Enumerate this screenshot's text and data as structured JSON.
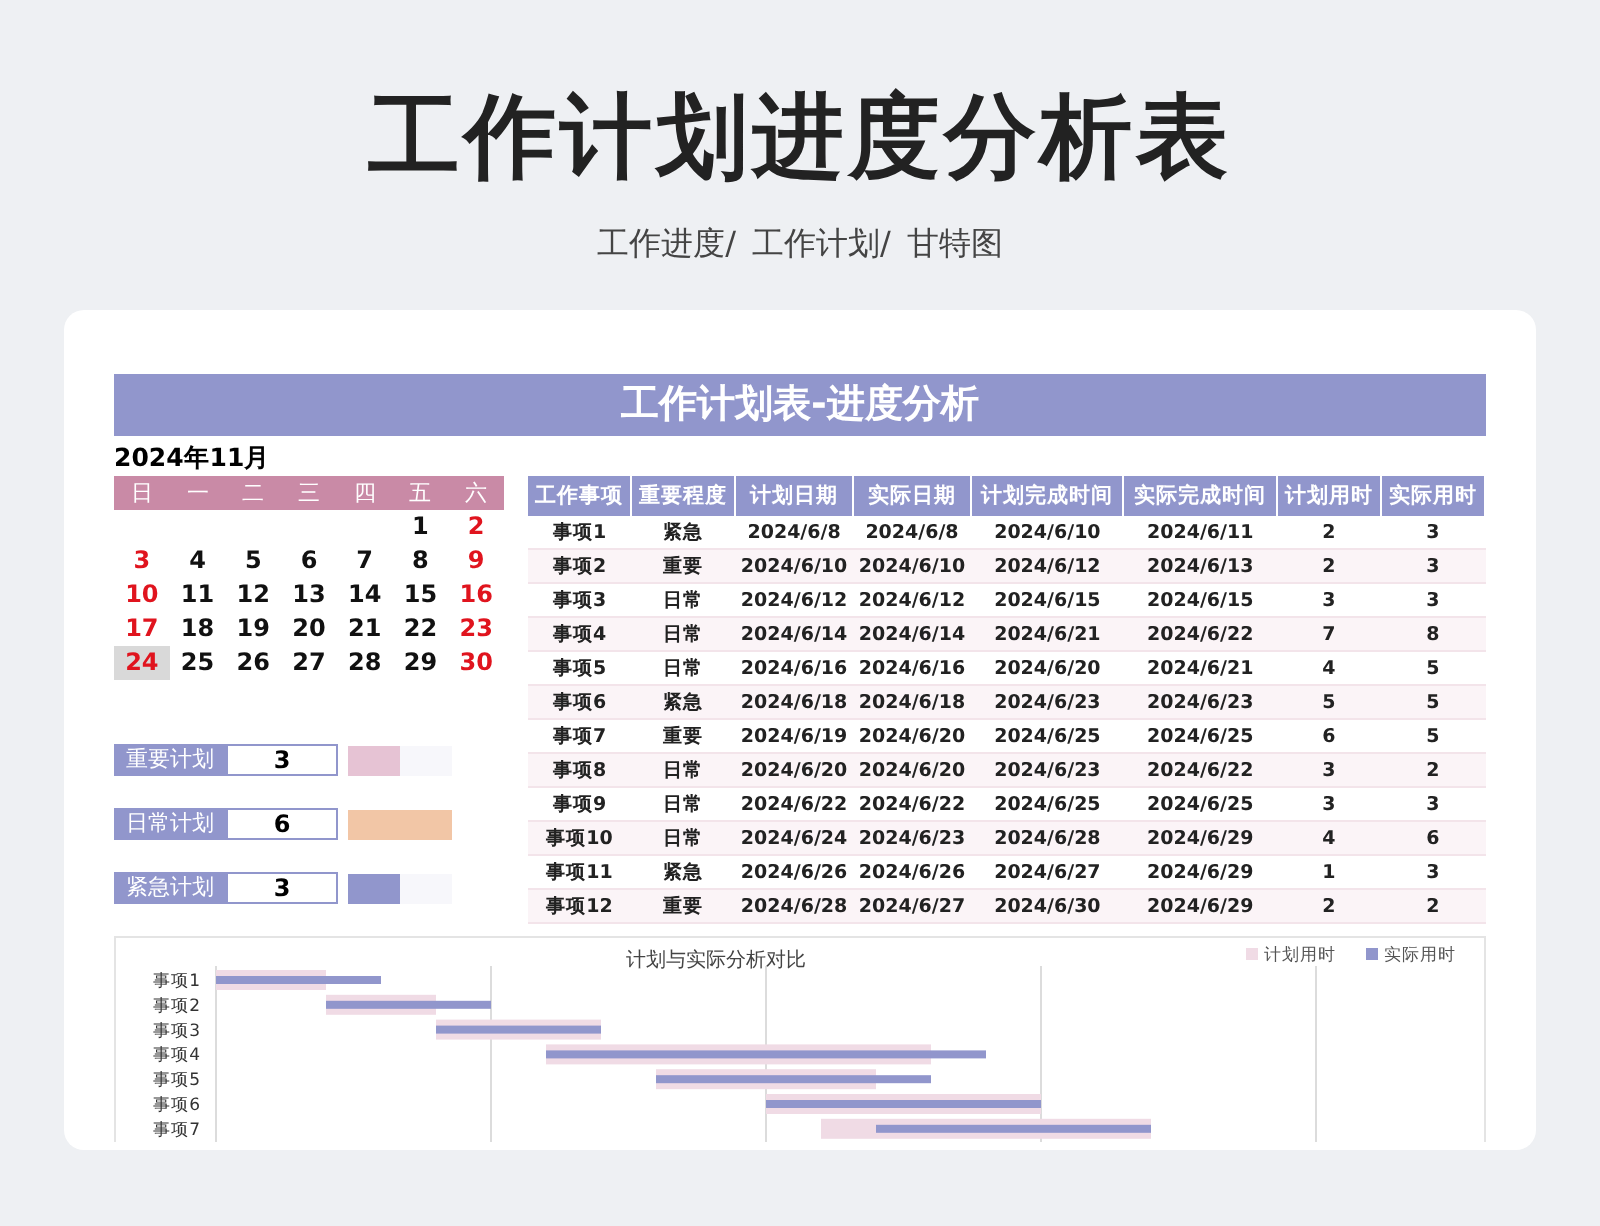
{
  "title": "工作计划进度分析表",
  "subtitle": [
    "工作进度/",
    "工作计划/",
    "甘特图"
  ],
  "banner": "工作计划表-进度分析",
  "calendar": {
    "month": "2024年11月",
    "weekdays": [
      "日",
      "一",
      "二",
      "三",
      "四",
      "五",
      "六"
    ],
    "weeks": [
      [
        {
          "day": "1",
          "selected": false
        },
        {
          "day": "2",
          "selected": false
        }
      ],
      [
        {
          "day": "3",
          "selected": false
        },
        {
          "day": "4",
          "selected": false
        },
        {
          "day": "5",
          "selected": false
        },
        {
          "day": "6",
          "selected": false
        },
        {
          "day": "7",
          "selected": false
        },
        {
          "day": "8",
          "selected": false
        },
        {
          "day": "9",
          "selected": false
        }
      ],
      [
        {
          "day": "10",
          "selected": false
        },
        {
          "day": "11",
          "selected": false
        },
        {
          "day": "12",
          "selected": false
        },
        {
          "day": "13",
          "selected": false
        },
        {
          "day": "14",
          "selected": false
        },
        {
          "day": "15",
          "selected": false
        },
        {
          "day": "16",
          "selected": false
        }
      ],
      [
        {
          "day": "17",
          "selected": false
        },
        {
          "day": "18",
          "selected": false
        },
        {
          "day": "19",
          "selected": false
        },
        {
          "day": "20",
          "selected": false
        },
        {
          "day": "21",
          "selected": false
        },
        {
          "day": "22",
          "selected": false
        },
        {
          "day": "23",
          "selected": false
        }
      ],
      [
        {
          "day": "24",
          "selected": true
        },
        {
          "day": "25",
          "selected": false
        },
        {
          "day": "26",
          "selected": false
        },
        {
          "day": "27",
          "selected": false
        },
        {
          "day": "28",
          "selected": false
        },
        {
          "day": "29",
          "selected": false
        },
        {
          "day": "30",
          "selected": false
        }
      ]
    ]
  },
  "summary": [
    {
      "label": "重要计划",
      "count": "3",
      "color": "#e6c3d4",
      "level": 0.5
    },
    {
      "label": "日常计划",
      "count": "6",
      "color": "#f2c6a6",
      "level": 1
    },
    {
      "label": "紧急计划",
      "count": "3",
      "color": "#9196cc",
      "level": 0.5
    }
  ],
  "table": {
    "columns": [
      "工作事项",
      "重要程度",
      "计划日期",
      "实际日期",
      "计划完成时间",
      "实际完成时间",
      "计划用时",
      "实际用时"
    ],
    "rows": [
      [
        "事项1",
        "紧急",
        "2024/6/8",
        "2024/6/8",
        "2024/6/10",
        "2024/6/11",
        "2",
        "3"
      ],
      [
        "事项2",
        "重要",
        "2024/6/10",
        "2024/6/10",
        "2024/6/12",
        "2024/6/13",
        "2",
        "3"
      ],
      [
        "事项3",
        "日常",
        "2024/6/12",
        "2024/6/12",
        "2024/6/15",
        "2024/6/15",
        "3",
        "3"
      ],
      [
        "事项4",
        "日常",
        "2024/6/14",
        "2024/6/14",
        "2024/6/21",
        "2024/6/22",
        "7",
        "8"
      ],
      [
        "事项5",
        "日常",
        "2024/6/16",
        "2024/6/16",
        "2024/6/20",
        "2024/6/21",
        "4",
        "5"
      ],
      [
        "事项6",
        "紧急",
        "2024/6/18",
        "2024/6/18",
        "2024/6/23",
        "2024/6/23",
        "5",
        "5"
      ],
      [
        "事项7",
        "重要",
        "2024/6/19",
        "2024/6/20",
        "2024/6/25",
        "2024/6/25",
        "6",
        "5"
      ],
      [
        "事项8",
        "日常",
        "2024/6/20",
        "2024/6/20",
        "2024/6/23",
        "2024/6/22",
        "3",
        "2"
      ],
      [
        "事项9",
        "日常",
        "2024/6/22",
        "2024/6/22",
        "2024/6/25",
        "2024/6/25",
        "3",
        "3"
      ],
      [
        "事项10",
        "日常",
        "2024/6/24",
        "2024/6/23",
        "2024/6/28",
        "2024/6/29",
        "4",
        "6"
      ],
      [
        "事项11",
        "紧急",
        "2024/6/26",
        "2024/6/26",
        "2024/6/27",
        "2024/6/29",
        "1",
        "3"
      ],
      [
        "事项12",
        "重要",
        "2024/6/28",
        "2024/6/27",
        "2024/6/30",
        "2024/6/29",
        "2",
        "2"
      ]
    ]
  },
  "gantt": {
    "title": "计划与实际分析对比",
    "legend": [
      {
        "name": "计划用时",
        "color": "#f0dbe5"
      },
      {
        "name": "实际用时",
        "color": "#9196cc"
      }
    ],
    "labels": [
      "事项1",
      "事项2",
      "事项3",
      "事项4",
      "事项5",
      "事项6",
      "事项7"
    ]
  }
}
